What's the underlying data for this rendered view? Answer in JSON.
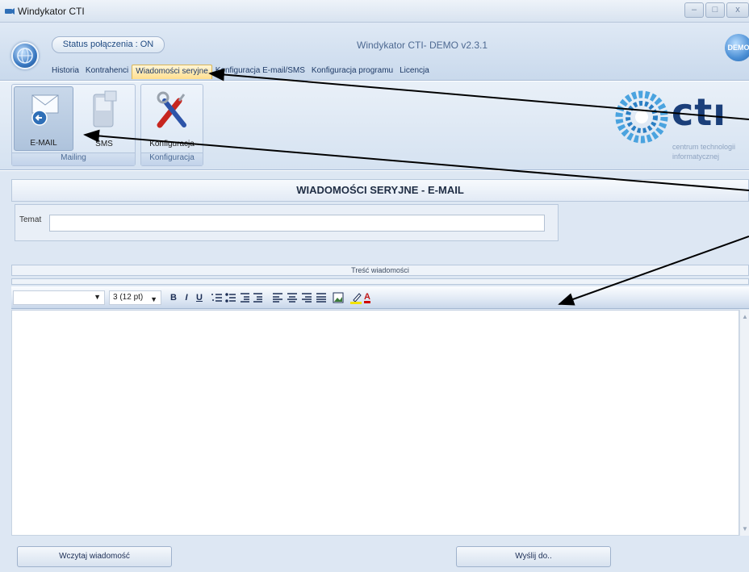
{
  "window": {
    "title": "Windykator CTI",
    "minimize_glyph": "–",
    "maximize_glyph": "□",
    "close_glyph": "x"
  },
  "header": {
    "status": "Status połączenia : ON",
    "app_title": "Windykator CTI- DEMO v2.3.1",
    "demo_badge": "DEMO"
  },
  "menu": {
    "items": [
      "Historia",
      "Kontrahenci",
      "Wiadomości seryjne",
      "Konfiguracja E-mail/SMS",
      "Konfiguracja programu",
      "Licencja"
    ],
    "active_index": 2
  },
  "ribbon": {
    "tools": {
      "email": "E-MAIL",
      "sms": "SMS",
      "config": "Konfiguracja"
    },
    "groups": {
      "mailing": "Mailing",
      "config": "Konfiguracja"
    }
  },
  "logo": {
    "text": "ctı",
    "line1": "centrum technologii",
    "line2": "informatycznej"
  },
  "page": {
    "title": "WIADOMOŚCI SERYJNE - E-MAIL"
  },
  "form": {
    "subject_label": "Temat",
    "subject_value": "",
    "body_label": "Treść wiadomości"
  },
  "editor_toolbar": {
    "font_value": "",
    "size_value": "3 (12 pt)",
    "bold": "B",
    "italic": "I",
    "underline": "U",
    "icons": [
      "numbered-list-icon",
      "bullet-list-icon",
      "outdent-icon",
      "indent-icon",
      "align-left-icon",
      "align-center-icon",
      "align-right-icon",
      "justify-icon",
      "image-icon",
      "highlight-icon",
      "font-color-icon"
    ],
    "font_color_glyph": "A"
  },
  "footer": {
    "load_button": "Wczytaj wiadomość",
    "send_button": "Wyślij do.."
  },
  "colors": {
    "accent": "#1b3f7a",
    "ribbon_bg": "#d5e2f1",
    "active_tab": "#ffdf8f"
  }
}
